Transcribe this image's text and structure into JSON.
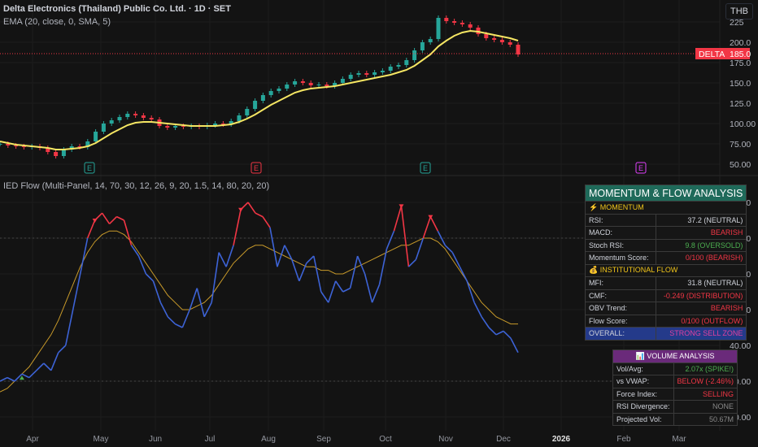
{
  "header": {
    "title": "Delta Electronics (Thailand) Public Co. Ltd. · 1D · SET",
    "ema_label": "EMA (20, close, 0, SMA, 5)",
    "currency": "THB",
    "indicator_label": "IED Flow (Multi-Panel, 14, 70, 30, 12, 26, 9, 20, 1.5, 14, 80, 20, 20)"
  },
  "colors": {
    "up": "#26a69a",
    "down": "#f23645",
    "ema": "#f5e663",
    "flow_low": "#3d63d6",
    "flow_high": "#f23645",
    "signal": "#c89a2a"
  },
  "momentum_panel": {
    "title": "MOMENTUM & FLOW ANALYSIS",
    "momentum_header": "⚡ MOMENTUM",
    "rows1": [
      {
        "label": "RSI:",
        "value": "37.2 (NEUTRAL)",
        "cls": "neu"
      },
      {
        "label": "MACD:",
        "value": "BEARISH",
        "cls": "red"
      },
      {
        "label": "Stoch RSI:",
        "value": "9.8 (OVERSOLD)",
        "cls": "grn"
      },
      {
        "label": "Momentum Score:",
        "value": "0/100 (BEARISH)",
        "cls": "red"
      }
    ],
    "flow_header": "💰 INSTITUTIONAL FLOW",
    "rows2": [
      {
        "label": "MFI:",
        "value": "31.8 (NEUTRAL)",
        "cls": "neu"
      },
      {
        "label": "CMF:",
        "value": "-0.249 (DISTRIBUTION)",
        "cls": "red"
      },
      {
        "label": "OBV Trend:",
        "value": "BEARISH",
        "cls": "red"
      },
      {
        "label": "Flow Score:",
        "value": "0/100 (OUTFLOW)",
        "cls": "red"
      }
    ],
    "overall_label": "OVERALL:",
    "overall_value": "STRONG SELL ZONE"
  },
  "volume_panel": {
    "title": "📊 VOLUME ANALYSIS",
    "rows": [
      {
        "label": "Vol/Avg:",
        "value": "2.07x (SPIKE!)",
        "cls": "grn"
      },
      {
        "label": "vs VWAP:",
        "value": "BELOW (-2.46%)",
        "cls": "red"
      },
      {
        "label": "Force Index:",
        "value": "SELLING",
        "cls": "red"
      },
      {
        "label": "RSI Divergence:",
        "value": "NONE",
        "cls": "gray"
      },
      {
        "label": "Projected Vol:",
        "value": "50.67M",
        "cls": "gray"
      }
    ]
  },
  "chart_data": {
    "type": "line",
    "title": "Delta Electronics (Thailand) Public Co. Ltd. · 1D · SET",
    "x_ticks": [
      "Apr",
      "May",
      "Jun",
      "Jul",
      "Aug",
      "Sep",
      "Oct",
      "Nov",
      "Dec",
      "2026",
      "Feb",
      "Mar"
    ],
    "price_axis": {
      "ticks": [
        "225",
        "200.0",
        "175.0",
        "150.0",
        "125.0",
        "100.00",
        "75.00",
        "50.00"
      ],
      "ylim": [
        40,
        235
      ]
    },
    "last_price": {
      "symbol": "DELTA",
      "value": "185.0"
    },
    "price_closes": [
      75,
      73,
      72,
      71,
      72,
      70,
      65,
      60,
      68,
      72,
      71,
      78,
      90,
      100,
      104,
      108,
      112,
      110,
      107,
      105,
      97,
      95,
      97,
      96,
      97,
      96,
      98,
      100,
      99,
      103,
      110,
      118,
      128,
      135,
      140,
      143,
      148,
      152,
      150,
      147,
      148,
      146,
      150,
      155,
      160,
      162,
      160,
      163,
      165,
      170,
      172,
      178,
      190,
      200,
      204,
      230,
      226,
      224,
      222,
      218,
      210,
      205,
      203,
      200,
      197,
      185
    ],
    "ema_values": [
      78,
      76,
      74,
      73,
      72,
      71,
      70,
      68,
      68,
      69,
      70,
      72,
      76,
      82,
      88,
      93,
      98,
      101,
      102,
      102,
      101,
      100,
      99,
      98,
      97,
      97,
      97,
      97,
      98,
      99,
      102,
      106,
      111,
      117,
      123,
      128,
      133,
      138,
      141,
      143,
      144,
      145,
      146,
      148,
      150,
      152,
      154,
      156,
      158,
      160,
      163,
      166,
      171,
      178,
      185,
      195,
      202,
      208,
      212,
      214,
      213,
      211,
      209,
      207,
      205,
      202
    ],
    "earnings": [
      {
        "label": "E",
        "color": "#26a69a"
      },
      {
        "label": "E",
        "color": "#f23645"
      },
      {
        "label": "E",
        "color": "#26a69a"
      },
      {
        "label": "E",
        "color": "#e040fb"
      }
    ],
    "indicator_axis": {
      "ticks": [
        "80.00",
        "70.00",
        "60.00",
        "50.00",
        "40.00",
        "30.00",
        "20.00"
      ],
      "ylim": [
        16,
        84
      ],
      "levels": [
        70,
        30
      ]
    },
    "flow_values": [
      30,
      31,
      30,
      32,
      31,
      33,
      35,
      33,
      38,
      40,
      50,
      60,
      70,
      75,
      77,
      74,
      76,
      75,
      68,
      65,
      60,
      58,
      52,
      48,
      46,
      45,
      50,
      56,
      48,
      52,
      66,
      62,
      68,
      78,
      80,
      77,
      76,
      73,
      62,
      68,
      64,
      58,
      63,
      65,
      55,
      52,
      58,
      55,
      56,
      65,
      60,
      52,
      57,
      67,
      72,
      79,
      62,
      64,
      70,
      76,
      72,
      68,
      66,
      62,
      58,
      52,
      48,
      45,
      43,
      44,
      42,
      38
    ],
    "signal_values": [
      27,
      28,
      30,
      32,
      34,
      37,
      40,
      43,
      47,
      52,
      57,
      62,
      66,
      69,
      71,
      72,
      72,
      71,
      69,
      66,
      63,
      60,
      57,
      54,
      52,
      50,
      50,
      51,
      52,
      54,
      57,
      60,
      63,
      65,
      67,
      68,
      68,
      67,
      66,
      65,
      64,
      63,
      62,
      62,
      61,
      61,
      60,
      60,
      61,
      62,
      63,
      64,
      65,
      66,
      67,
      68,
      68,
      69,
      70,
      70,
      69,
      67,
      64,
      61,
      58,
      55,
      52,
      50,
      48,
      47,
      46,
      46
    ]
  }
}
